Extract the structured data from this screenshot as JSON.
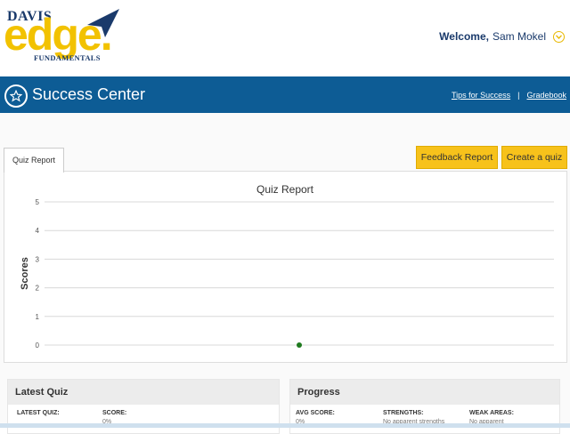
{
  "brand": {
    "davis": "DAVIS",
    "edge": "edge.",
    "fundamentals": "FUNDAMENTALS"
  },
  "user": {
    "welcome": "Welcome,",
    "name": "Sam Mokel"
  },
  "bar": {
    "title": "Success Center",
    "link_tips": "Tips for Success",
    "separator": "|",
    "link_gradebook": "Gradebook"
  },
  "tabs": {
    "quiz_report": "Quiz Report"
  },
  "buttons": {
    "feedback": "Feedback Report",
    "create": "Create a quiz"
  },
  "chart_data": {
    "type": "scatter",
    "title": "Quiz Report",
    "ylabel": "Scores",
    "xlabel": "",
    "ylim": [
      0,
      5
    ],
    "yticks": [
      "0",
      "1",
      "2",
      "3",
      "4",
      "5"
    ],
    "points": [
      {
        "x": 0.5,
        "y": 0
      }
    ],
    "grid": true,
    "colors": {
      "point": "#1f7a1f",
      "grid": "#d8d8d8"
    }
  },
  "latest_quiz": {
    "title": "Latest Quiz",
    "label_quiz": "LATEST QUIZ:",
    "label_score": "SCORE:",
    "score_value": "0%"
  },
  "progress": {
    "title": "Progress",
    "label_avg": "AVG SCORE:",
    "label_strengths": "STRENGTHS:",
    "label_weak": "WEAK AREAS:",
    "avg_value": "0%",
    "strengths_value": "No apparent strengths",
    "weak_value": "No apparent"
  },
  "colors": {
    "brand_blue": "#0d5c95",
    "accent_yellow": "#f7c21b"
  }
}
